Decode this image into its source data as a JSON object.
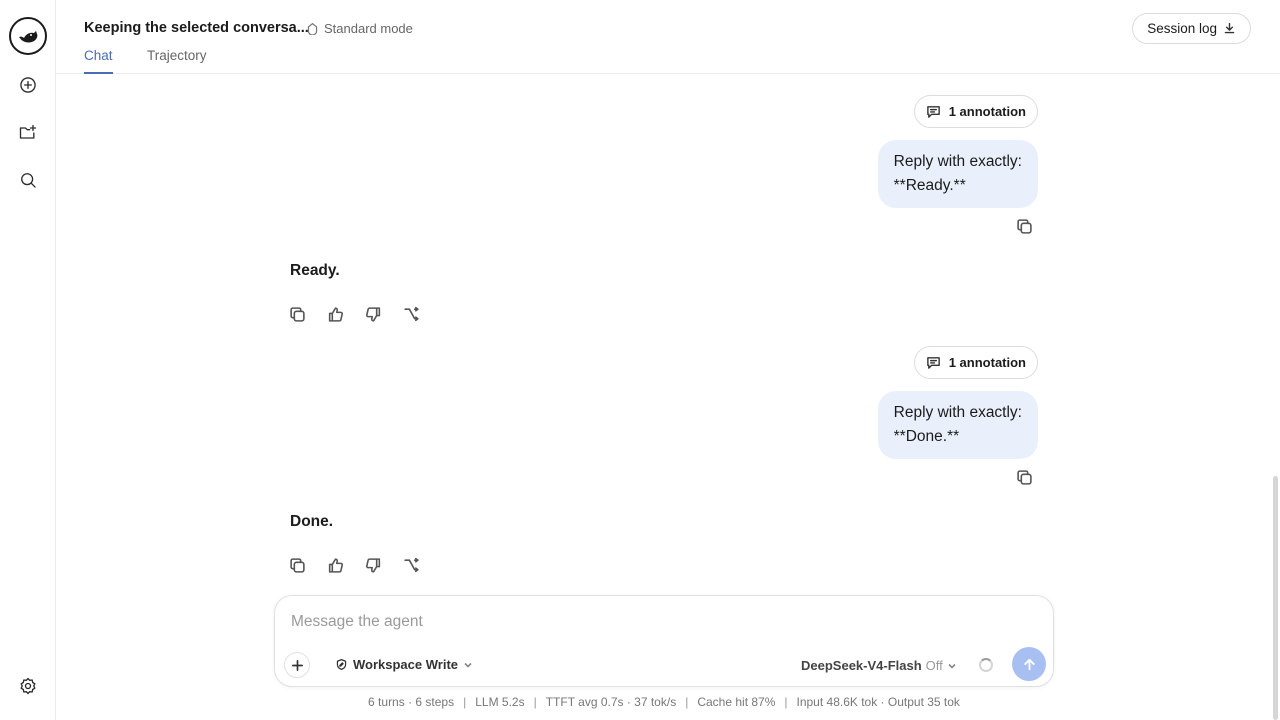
{
  "header": {
    "title": "Keeping the selected conversa...",
    "mode": "Standard mode",
    "tabs": [
      {
        "label": "Chat",
        "active": true
      },
      {
        "label": "Trajectory",
        "active": false
      }
    ],
    "session_log": "Session log"
  },
  "rail": {
    "icons": [
      "app-logo",
      "new-chat-icon",
      "new-folder-icon",
      "search-icon",
      "settings-icon"
    ]
  },
  "messages": [
    {
      "annotation": "1 annotation",
      "user_line1": "Reply with exactly:",
      "user_line2": "**Ready.**",
      "reply": "Ready."
    },
    {
      "annotation": "1 annotation",
      "user_line1": "Reply with exactly:",
      "user_line2": "**Done.**",
      "reply": "Done."
    }
  ],
  "composer": {
    "placeholder": "Message the agent",
    "workspace": "Workspace Write",
    "model": "DeepSeek-V4-Flash",
    "thinking": "Off"
  },
  "stats": {
    "turns": "6 turns · 6 steps",
    "llm": "LLM 5.2s",
    "ttft": "TTFT avg 0.7s · 37 tok/s",
    "cache": "Cache hit 87%",
    "tokens": "Input 48.6K tok · Output 35 tok"
  },
  "colors": {
    "accent": "#4a6bb5",
    "bubble": "#eaf0fb",
    "send": "#a8bff2"
  }
}
